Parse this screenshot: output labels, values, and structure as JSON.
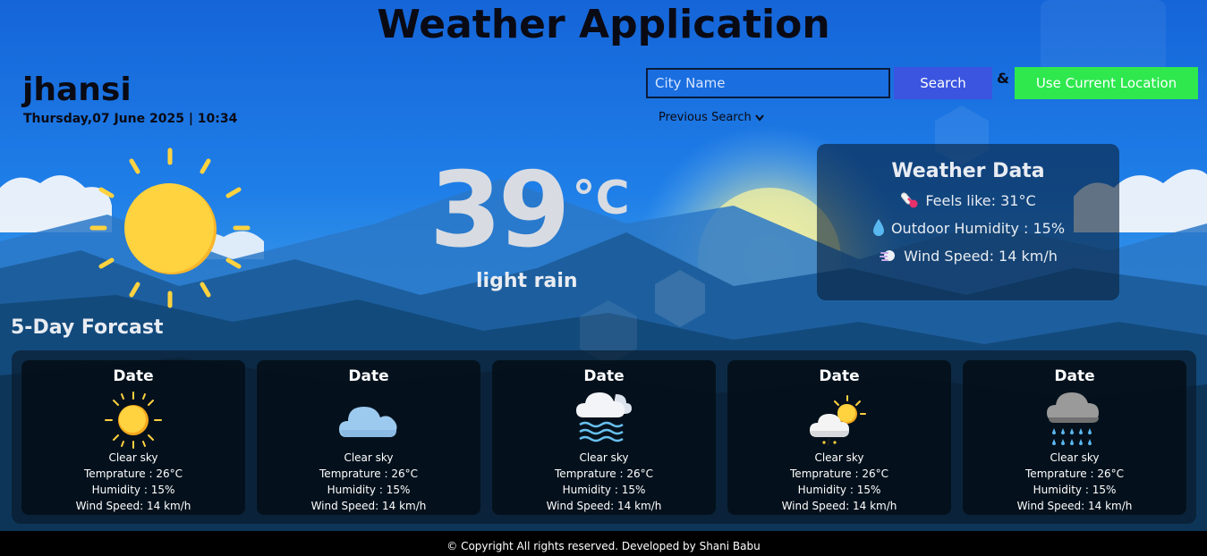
{
  "app": {
    "title": "Weather Application"
  },
  "location": {
    "city": "jhansi",
    "datetime": "Thursday,07 June 2025 | 10:34"
  },
  "search": {
    "placeholder": "City Name",
    "button_label": "Search",
    "separator": "&",
    "location_button_label": "Use Current Location",
    "previous_label": "Previous Search"
  },
  "current": {
    "icon": "sun-icon",
    "temperature": "39",
    "unit": "°C",
    "condition": "light rain"
  },
  "weather_data": {
    "title": "Weather Data",
    "feels_like": "Feels like: 31°C",
    "humidity": "Outdoor Humidity : 15%",
    "wind": "Wind Speed: 14 km/h"
  },
  "forecast": {
    "title": "5-Day Forcast",
    "days": [
      {
        "date": "Date",
        "icon": "sun-icon",
        "condition": "Clear sky",
        "temperature": "Temprature : 26°C",
        "humidity": "Humidity : 15%",
        "wind": "Wind Speed: 14 km/h"
      },
      {
        "date": "Date",
        "icon": "cloud-icon",
        "condition": "Clear sky",
        "temperature": "Temprature : 26°C",
        "humidity": "Humidity : 15%",
        "wind": "Wind Speed: 14 km/h"
      },
      {
        "date": "Date",
        "icon": "fog-icon",
        "condition": "Clear sky",
        "temperature": "Temprature : 26°C",
        "humidity": "Humidity : 15%",
        "wind": "Wind Speed: 14 km/h"
      },
      {
        "date": "Date",
        "icon": "partly-cloudy-icon",
        "condition": "Clear sky",
        "temperature": "Temprature : 26°C",
        "humidity": "Humidity : 15%",
        "wind": "Wind Speed: 14 km/h"
      },
      {
        "date": "Date",
        "icon": "rain-cloud-icon",
        "condition": "Clear sky",
        "temperature": "Temprature : 26°C",
        "humidity": "Humidity : 15%",
        "wind": "Wind Speed: 14 km/h"
      }
    ]
  },
  "footer": {
    "text": "© Copyright All rights reserved. Developed by Shani Babu"
  },
  "colors": {
    "search_button": "#3b55e0",
    "location_button": "#2ee84e",
    "sun": "#ffd23f"
  }
}
